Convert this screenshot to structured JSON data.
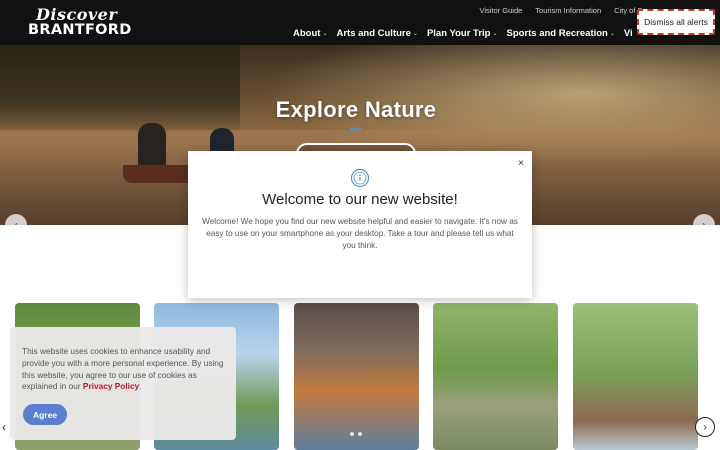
{
  "header": {
    "logo_script": "Discover",
    "logo_word": "BRANTFORD",
    "utility_links": [
      "Visitor Guide",
      "Tourism Information",
      "City of Br"
    ],
    "nav": [
      {
        "label": "About"
      },
      {
        "label": "Arts and Culture"
      },
      {
        "label": "Plan Your Trip"
      },
      {
        "label": "Sports and Recreation"
      },
      {
        "label": "Vi"
      }
    ]
  },
  "alerts": {
    "dismiss_label": "Dismiss all alerts"
  },
  "hero": {
    "title": "Explore Nature"
  },
  "modal": {
    "title": "Welcome to our new website!",
    "body": "Welcome! We hope you find our new website helpful and easier to navigate. It's now as easy to use on your smartphone as your desktop. Take a tour and please tell us what you think.",
    "close_glyph": "×"
  },
  "cookie": {
    "text": "This website uses cookies to enhance usability and provide you with a more personal experience. By using this website, you agree to our use of cookies as explained in our",
    "link": "Privacy Policy",
    "period": ".",
    "agree_label": "Agree"
  },
  "icons": {
    "chevron_left": "‹",
    "chevron_right": "›",
    "nav_chevron": "⌄"
  },
  "colors": {
    "header_bg": "#111111",
    "accent_blue": "#5a7fcf",
    "link_red": "#b31b2c"
  }
}
